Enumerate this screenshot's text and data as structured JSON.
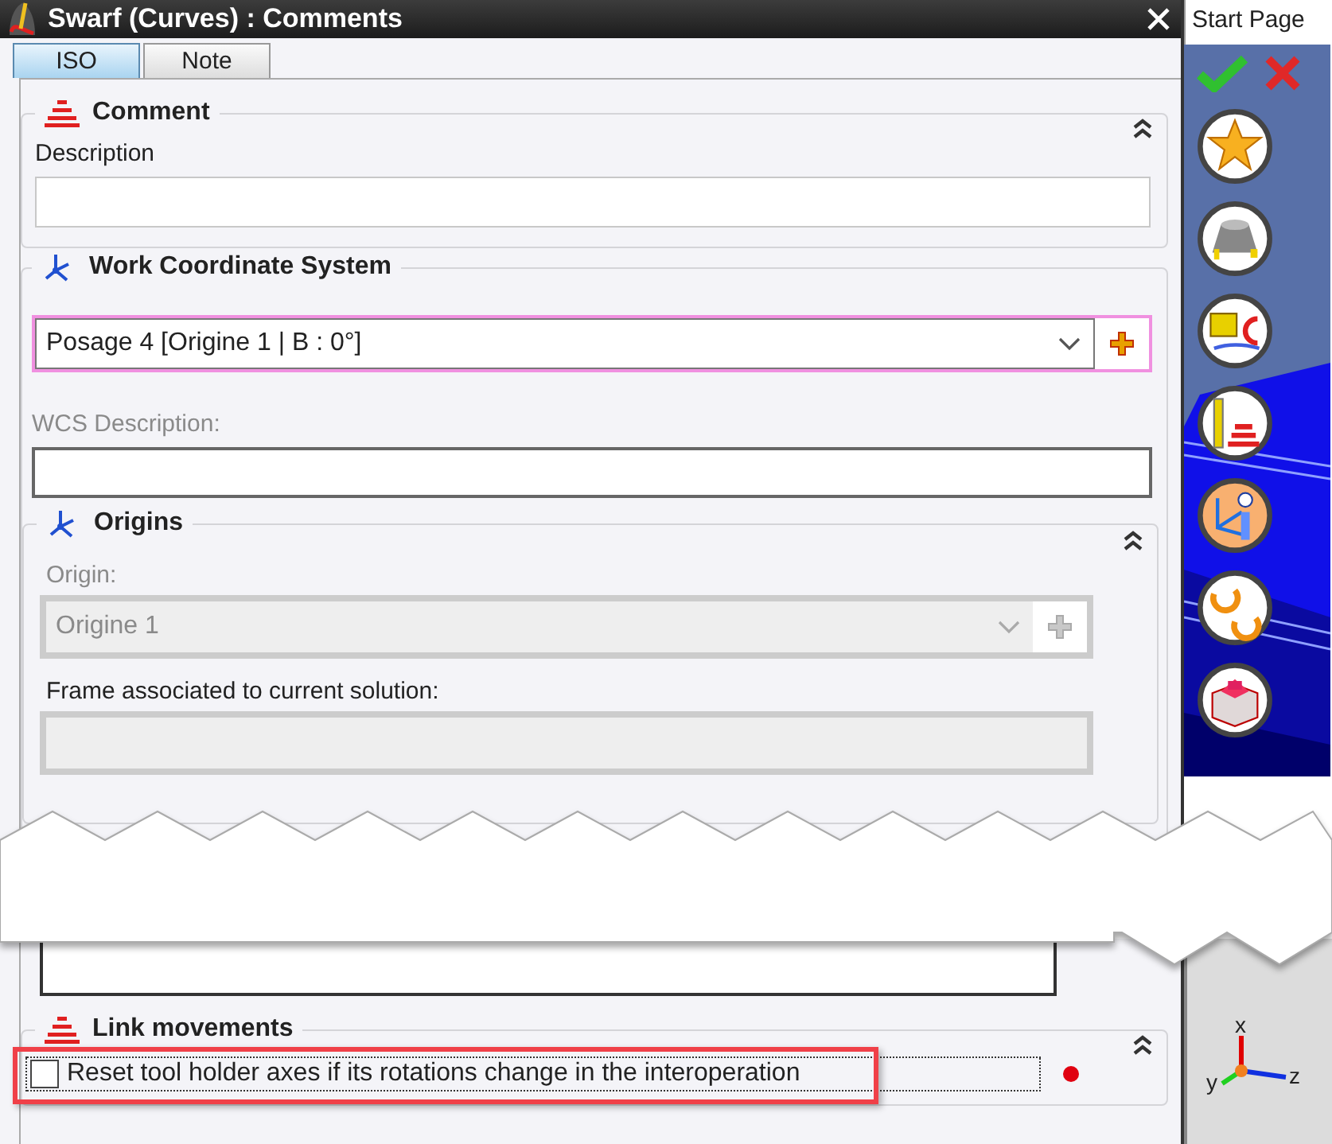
{
  "window": {
    "title": "Swarf (Curves) : Comments"
  },
  "tabs": [
    {
      "label": "ISO",
      "selected": true
    },
    {
      "label": "Note",
      "selected": false
    }
  ],
  "comment": {
    "title": "Comment",
    "label": "Description"
  },
  "wcs": {
    "title": "Work Coordinate System",
    "selection": "Posage 4 [Origine 1 | B : 0°]",
    "description_label": "WCS Description:",
    "description_disabled": true,
    "origins": {
      "title": "Origins",
      "origin_label": "Origin:",
      "origin_value": "Origine 1",
      "origin_disabled": true,
      "frame_label": "Frame associated to current solution:"
    }
  },
  "link_movements": {
    "title": "Link movements",
    "option": {
      "label": "Reset tool holder axes if its rotations change in the interoperation",
      "checked": false
    }
  },
  "side_panel": {
    "tab": "Start Page",
    "axis_labels": [
      "x",
      "y",
      "z"
    ]
  }
}
